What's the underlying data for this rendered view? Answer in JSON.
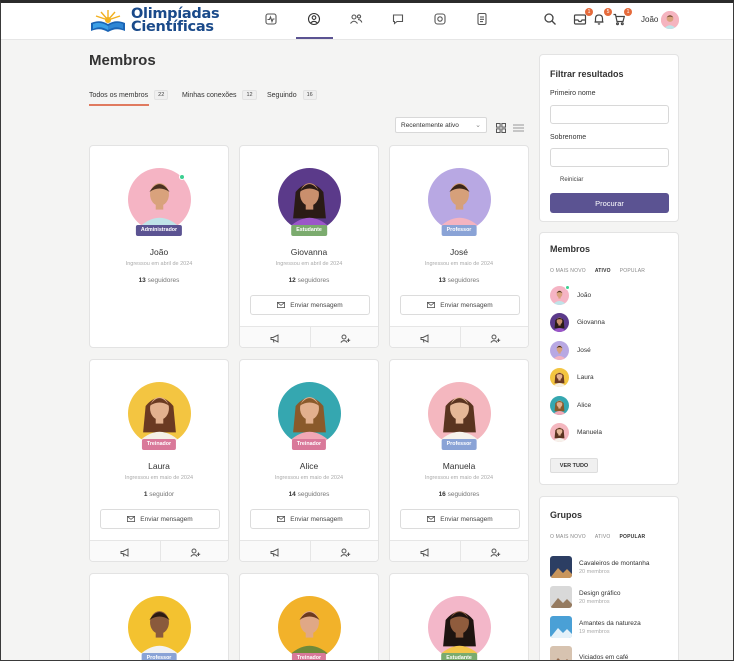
{
  "brand": {
    "line1": "Olimpíadas",
    "line2": "Científicas"
  },
  "header": {
    "nav": [
      {
        "icon": "activity-icon"
      },
      {
        "icon": "profile-icon",
        "active": true
      },
      {
        "icon": "people-icon"
      },
      {
        "icon": "chat-icon"
      },
      {
        "icon": "groups-icon"
      },
      {
        "icon": "document-icon"
      }
    ],
    "badges": {
      "messages": "1",
      "notifications": "5",
      "cart": "1"
    },
    "username": "João"
  },
  "page": {
    "title": "Membros"
  },
  "tabs": [
    {
      "label": "Todos os membros",
      "count": "22",
      "active": true
    },
    {
      "label": "Minhas conexões",
      "count": "12"
    },
    {
      "label": "Seguindo",
      "count": "16"
    }
  ],
  "sort": {
    "value": "Recentemente ativo"
  },
  "members": [
    {
      "name": "João",
      "role": "Administrador",
      "joined": "Ingressou em abril de 2024",
      "followers_count": "13",
      "followers_word": "seguidores",
      "online": true
    },
    {
      "name": "Giovanna",
      "role": "Estudante",
      "joined": "Ingressou em abril de 2024",
      "followers_count": "12",
      "followers_word": "seguidores",
      "message": "Enviar mensagem"
    },
    {
      "name": "José",
      "role": "Professor",
      "joined": "Ingressou em maio de 2024",
      "followers_count": "13",
      "followers_word": "seguidores",
      "message": "Enviar mensagem"
    },
    {
      "name": "Laura",
      "role": "Treinador",
      "joined": "Ingressou em maio de 2024",
      "followers_count": "1",
      "followers_word": "seguidor",
      "message": "Enviar mensagem"
    },
    {
      "name": "Alice",
      "role": "Treinador",
      "joined": "Ingressou em maio de 2024",
      "followers_count": "14",
      "followers_word": "seguidores",
      "message": "Enviar mensagem"
    },
    {
      "name": "Manuela",
      "role": "Professor",
      "joined": "Ingressou em maio de 2024",
      "followers_count": "16",
      "followers_word": "seguidores",
      "message": "Enviar mensagem"
    },
    {
      "role": "Professor"
    },
    {
      "role": "Treinador"
    },
    {
      "role": "Estudante"
    }
  ],
  "colors": {
    "Administrador": "#5b5392",
    "Estudante": "#7bab6e",
    "Professor": "#8aa3d6",
    "Treinador": "#d9799a",
    "accent": "#5b5392",
    "tab_underline": "#e07a5f",
    "online": "#3ccf91"
  },
  "filter": {
    "title": "Filtrar resultados",
    "first_name_label": "Primeiro nome",
    "last_name_label": "Sobrenome",
    "reset": "Reiniciar",
    "search": "Procurar"
  },
  "sidebar_members": {
    "title": "Membros",
    "tabs": [
      "O MAIS NOVO",
      "ATIVO",
      "POPULAR"
    ],
    "list": [
      "João",
      "Giovanna",
      "José",
      "Laura",
      "Alice",
      "Manuela"
    ],
    "view_all": "VER TUDO"
  },
  "groups": {
    "title": "Grupos",
    "tabs": [
      "O MAIS NOVO",
      "ATIVO",
      "POPULAR"
    ],
    "list": [
      {
        "name": "Cavaleiros de montanha",
        "members": "20 membros"
      },
      {
        "name": "Design gráfico",
        "members": "20 membros"
      },
      {
        "name": "Amantes da natureza",
        "members": "19 membros"
      },
      {
        "name": "Viciados em café"
      }
    ]
  }
}
